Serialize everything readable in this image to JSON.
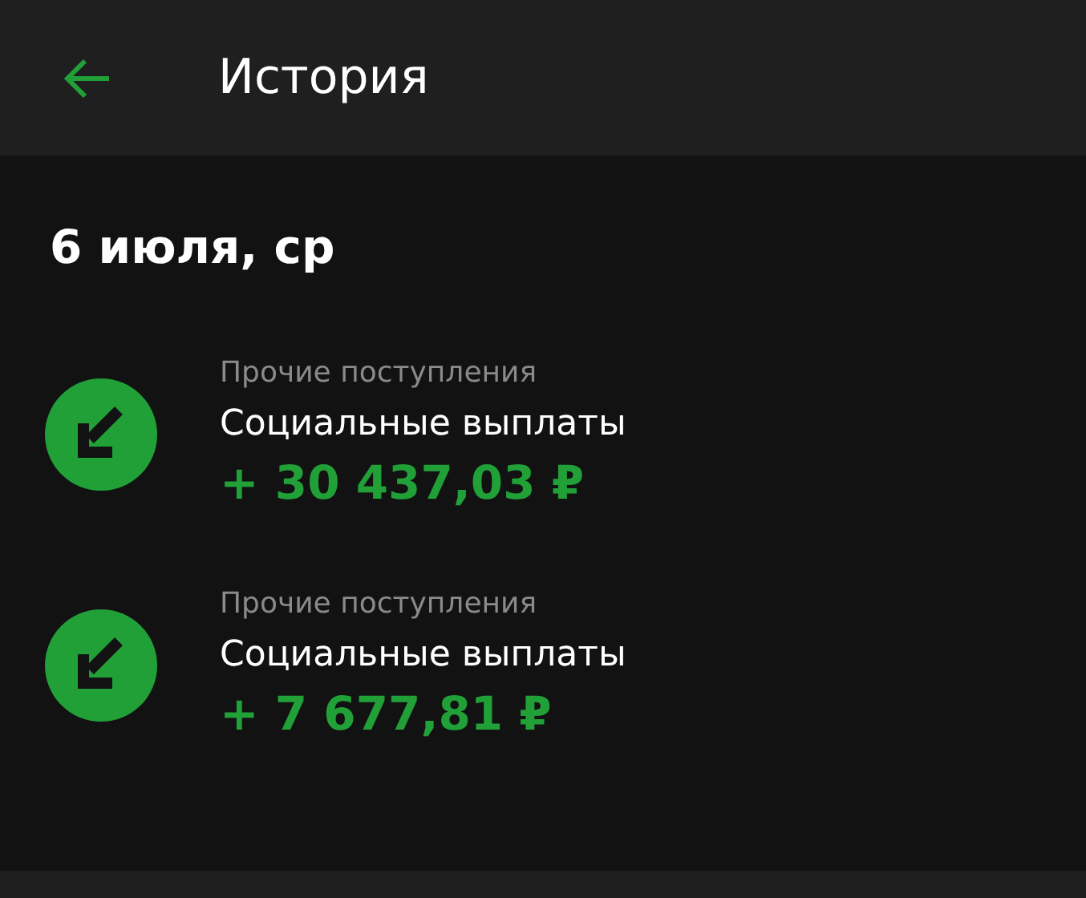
{
  "header": {
    "title": "История"
  },
  "date": "6 июля, ср",
  "operations": [
    {
      "category": "Прочие поступления",
      "title": "Социальные выплаты",
      "amount": "+ 30 437,03 ₽"
    },
    {
      "category": "Прочие поступления",
      "title": "Социальные выплаты",
      "amount": "+ 7 677,81 ₽"
    }
  ]
}
